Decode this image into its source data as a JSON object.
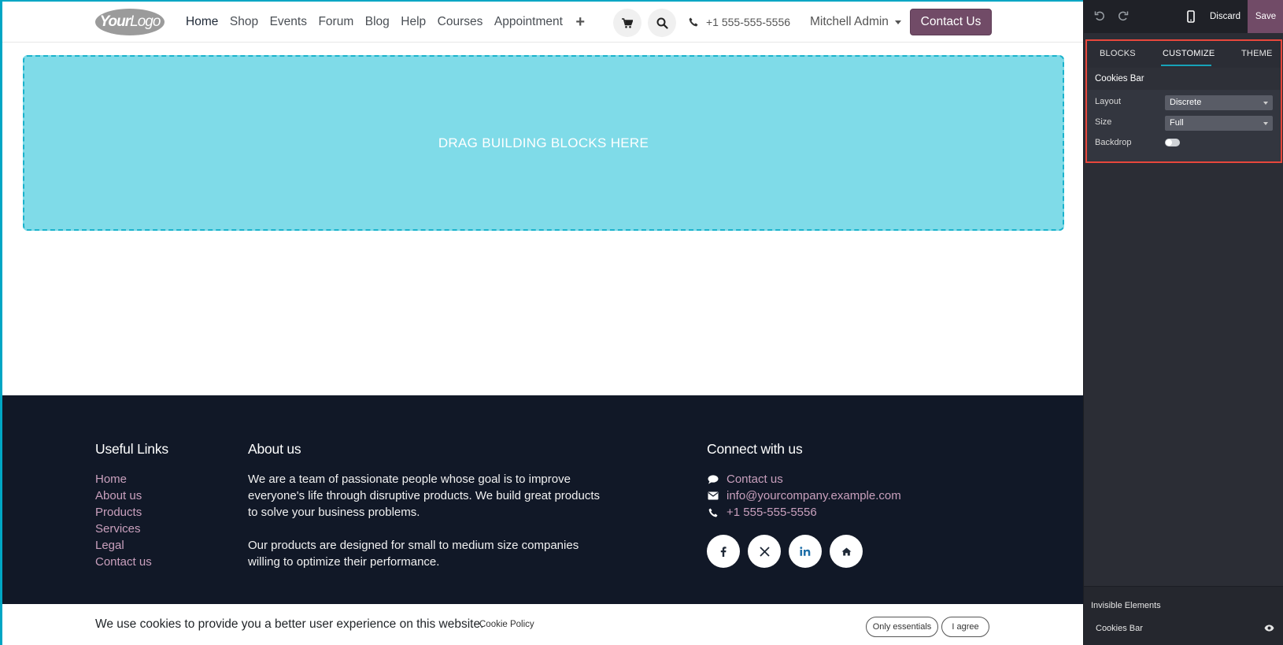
{
  "navbar": {
    "logo": {
      "part1": "Your",
      "part2": "Logo"
    },
    "links": [
      "Home",
      "Shop",
      "Events",
      "Forum",
      "Blog",
      "Help",
      "Courses",
      "Appointment"
    ],
    "active_link": "Home",
    "plus": "+",
    "phone": "+1 555-555-5556",
    "user": "Mitchell Admin",
    "contact_button": "Contact Us"
  },
  "dropzone": {
    "text": "DRAG BUILDING BLOCKS HERE"
  },
  "footer": {
    "useful_links": {
      "title": "Useful Links",
      "items": [
        "Home",
        "About us",
        "Products",
        "Services",
        "Legal",
        "Contact us"
      ]
    },
    "about": {
      "title": "About us",
      "para1": "We are a team of passionate people whose goal is to improve everyone's life through disruptive products. We build great products to solve your business problems.",
      "para2": "Our products are designed for small to medium size companies willing to optimize their performance."
    },
    "connect": {
      "title": "Connect with us",
      "contact": "Contact us",
      "email": "info@yourcompany.example.com",
      "phone": "+1 555-555-5556",
      "socials": [
        "facebook-icon",
        "x-icon",
        "linkedin-icon",
        "home-icon"
      ]
    }
  },
  "cookie_bar": {
    "message": "We use cookies to provide you a better user experience on this website.",
    "policy": "Cookie Policy",
    "only_essentials": "Only essentials",
    "agree": "I agree"
  },
  "editor": {
    "discard": "Discard",
    "save": "Save",
    "tabs": [
      "BLOCKS",
      "CUSTOMIZE",
      "THEME"
    ],
    "active_tab": "CUSTOMIZE",
    "section_title": "Cookies Bar",
    "options": {
      "layout_label": "Layout",
      "layout_value": "Discrete",
      "size_label": "Size",
      "size_value": "Full",
      "backdrop_label": "Backdrop",
      "backdrop_on": false
    },
    "invisible_title": "Invisible Elements",
    "invisible_item": "Cookies Bar"
  },
  "colors": {
    "brand": "#714b67",
    "highlight": "#e8473c",
    "accent": "#17a2b8",
    "footer_bg": "#111827",
    "dropzone_bg": "#7fdbe8"
  }
}
